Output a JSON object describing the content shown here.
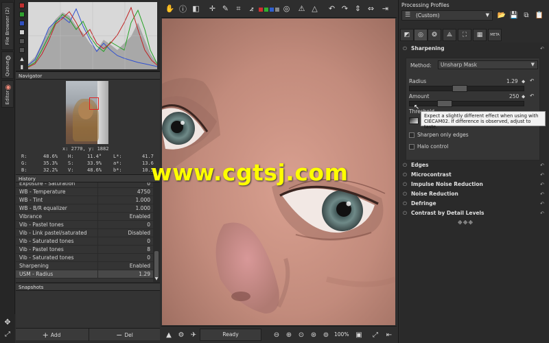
{
  "left_tabs": {
    "file_browser": "File Browser (2)",
    "queue": "Queue",
    "editor": "Editor"
  },
  "navigator": {
    "title": "Navigator",
    "coords": "x: 2770, y: 1882",
    "readout": {
      "r_label": "R:",
      "r": "48.6%",
      "h_label": "H:",
      "h": "11.4°",
      "l_label": "L*:",
      "l": "41.7",
      "g_label": "G:",
      "g": "35.3%",
      "s_label": "S:",
      "s": "33.9%",
      "a_label": "a*:",
      "a": "13.6",
      "b_label": "B:",
      "b": "32.2%",
      "v_label": "V:",
      "v": "48.6%",
      "bb_label": "b*:",
      "bb": "10.5"
    }
  },
  "history": {
    "title": "History",
    "rows": [
      {
        "name": "Exposure - Saturation",
        "value": "0"
      },
      {
        "name": "WB - Temperature",
        "value": "4750"
      },
      {
        "name": "WB - Tint",
        "value": "1.000"
      },
      {
        "name": "WB - B/R equalizer",
        "value": "1.000"
      },
      {
        "name": "Vibrance",
        "value": "Enabled"
      },
      {
        "name": "Vib - Pastel tones",
        "value": "0"
      },
      {
        "name": "Vib - Link pastel/saturated",
        "value": "Disabled"
      },
      {
        "name": "Vib - Saturated tones",
        "value": "0"
      },
      {
        "name": "Vib - Pastel tones",
        "value": "8"
      },
      {
        "name": "Vib - Saturated tones",
        "value": "0"
      },
      {
        "name": "Sharpening",
        "value": "Enabled"
      },
      {
        "name": "USM - Radius",
        "value": "1.29"
      }
    ],
    "selected_index": 11
  },
  "snapshots": {
    "title": "Snapshots",
    "add_label": "Add",
    "del_label": "Del"
  },
  "status": {
    "text": "Ready",
    "zoom": "100%"
  },
  "watermark": "www.cgtsj.com",
  "profiles": {
    "label": "Processing Profiles",
    "selected": "(Custom)"
  },
  "right_tabs": [
    "exposure",
    "detail",
    "color",
    "advanced",
    "transform",
    "raw",
    "meta"
  ],
  "sharpening": {
    "title": "Sharpening",
    "method_label": "Method:",
    "method_value": "Unsharp Mask",
    "radius_label": "Radius",
    "radius_value": "1.29",
    "amount_label": "Amount",
    "amount_value": "250",
    "threshold_label": "Threshold",
    "sharpen_edges_label": "Sharpen only edges",
    "halo_label": "Halo control",
    "tooltip": "Expect a slightly different effect when using with CIECAM02. If difference is observed, adjust to taste."
  },
  "tools": [
    {
      "name": "Edges"
    },
    {
      "name": "Microcontrast"
    },
    {
      "name": "Impulse Noise Reduction"
    },
    {
      "name": "Noise Reduction"
    },
    {
      "name": "Defringe"
    },
    {
      "name": "Contrast by Detail Levels"
    }
  ],
  "colors": {
    "panel": "#2c2c2c",
    "highlight": "#484848",
    "watermark": "#ffff00"
  }
}
